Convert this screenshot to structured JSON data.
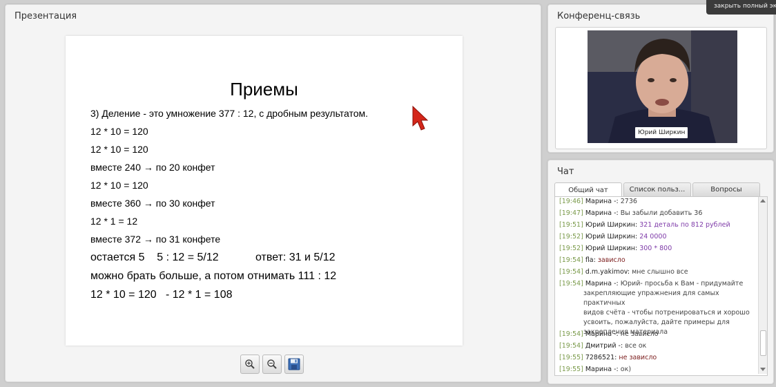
{
  "fullscreen_button": "закрыть полный экр",
  "presentation": {
    "title": "Презентация",
    "slide": {
      "heading": "Приемы",
      "lines": [
        "3) Деление - это умножение 377 : 12, с дробным результатом.",
        "12 * 10 = 120",
        "12 * 10 = 120",
        "вместе 240 → по 20 конфет",
        "12 * 10 = 120",
        "вместе 360 → по 30 конфет",
        "12 * 1 = 12",
        "вместе 372 → по 31 конфете",
        "остается 5    5 : 12 = 5/12            ответ: 31 и 5/12",
        "можно брать больше, а потом отнимать 111 : 12",
        "12 * 10 = 120   - 12 * 1 = 108"
      ]
    },
    "toolbar": {
      "zoom_in": "zoom-in-icon",
      "zoom_out": "zoom-out-icon",
      "save": "save-icon"
    }
  },
  "conference": {
    "title": "Конференц-связь",
    "participant_name": "Юрий Ширкин"
  },
  "chat": {
    "title": "Чат",
    "tabs": [
      "Общий чат",
      "Список польз...",
      "Вопросы"
    ],
    "messages": [
      {
        "time": "[19:46]",
        "author": "Марина -:",
        "text": "2736"
      },
      {
        "time": "[19:47]",
        "author": "Марина -:",
        "text": "Вы забыли добавить 36"
      },
      {
        "time": "[19:51]",
        "author": "Юрий Ширкин:",
        "text": "321 деталь по 812 рублей"
      },
      {
        "time": "[19:52]",
        "author": "Юрий Ширкин:",
        "text": "24 0000"
      },
      {
        "time": "[19:52]",
        "author": "Юрий Ширкин:",
        "text": "300 * 800"
      },
      {
        "time": "[19:54]",
        "author": "fla:",
        "text": "зависло"
      },
      {
        "time": "[19:54]",
        "author": "d.m.yakimov:",
        "text": "мне слышно все"
      },
      {
        "time": "[19:54]",
        "author": "Марина -:",
        "text": "Юрий- просьба к Вам - придумайте",
        "cont": [
          "закрепляющие упражнения для самых практичных",
          "видов счёта - чтобы потренироваться и хорошо",
          "усвоить, пожалуйста, дайте примеры для",
          "закрепления материала"
        ]
      },
      {
        "time": "[19:54]",
        "author": "Марина -:",
        "text": "не зависло"
      },
      {
        "time": "[19:54]",
        "author": "Дмитрий -:",
        "text": "все ок"
      },
      {
        "time": "[19:55]",
        "author": "7286521:",
        "text": "не зависло"
      },
      {
        "time": "[19:55]",
        "author": "Марина -:",
        "text": "ок)"
      }
    ],
    "colors": {
      "timestamp": "#7a9a4a",
      "purple": "#7e3aa8",
      "maroon": "#7a1b1b"
    }
  }
}
